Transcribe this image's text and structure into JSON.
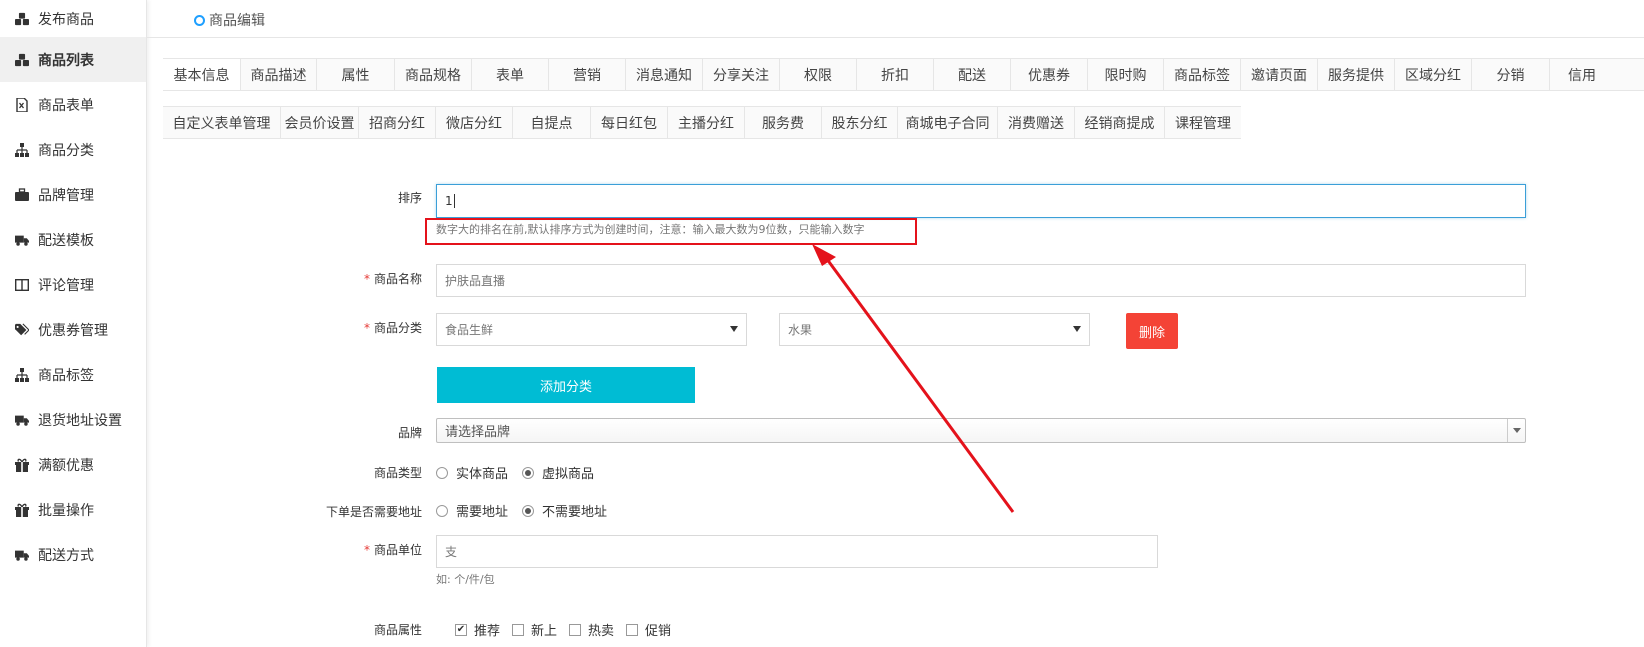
{
  "sidebar": {
    "items": [
      {
        "label": "发布商品",
        "icon": "cubes-icon",
        "active": false
      },
      {
        "label": "商品列表",
        "icon": "cubes-icon",
        "active": true
      },
      {
        "label": "商品表单",
        "icon": "excel-file-icon",
        "active": false
      },
      {
        "label": "商品分类",
        "icon": "sitemap-icon",
        "active": false
      },
      {
        "label": "品牌管理",
        "icon": "briefcase-icon",
        "active": false
      },
      {
        "label": "配送模板",
        "icon": "truck-icon",
        "active": false
      },
      {
        "label": "评论管理",
        "icon": "columns-icon",
        "active": false
      },
      {
        "label": "优惠券管理",
        "icon": "tags-icon",
        "active": false
      },
      {
        "label": "商品标签",
        "icon": "sitemap-icon",
        "active": false
      },
      {
        "label": "退货地址设置",
        "icon": "truck-icon",
        "active": false
      },
      {
        "label": "满额优惠",
        "icon": "gift-icon",
        "active": false
      },
      {
        "label": "批量操作",
        "icon": "gift-icon",
        "active": false
      },
      {
        "label": "配送方式",
        "icon": "truck-icon",
        "active": false
      }
    ]
  },
  "header": {
    "breadcrumb": "商品编辑"
  },
  "tabs_row1": [
    "基本信息",
    "商品描述",
    "属性",
    "商品规格",
    "表单",
    "营销",
    "消息通知",
    "分享关注",
    "权限",
    "折扣",
    "配送",
    "优惠券",
    "限时购",
    "商品标签",
    "邀请页面",
    "服务提供",
    "区域分红",
    "分销",
    "信用"
  ],
  "tabs_row2": [
    "自定义表单管理",
    "会员价设置",
    "招商分红",
    "微店分红",
    "自提点",
    "每日红包",
    "主播分红",
    "服务费",
    "股东分红",
    "商城电子合同",
    "消费赠送",
    "经销商提成",
    "课程管理"
  ],
  "form": {
    "sort": {
      "label": "排序",
      "value": "1",
      "hint": "数字大的排名在前,默认排序方式为创建时间，注意：输入最大数为9位数，只能输入数字"
    },
    "name": {
      "required": "*",
      "label": "商品名称",
      "value": "护肤品直播"
    },
    "category": {
      "required": "*",
      "label": "商品分类",
      "primary": "食品生鲜",
      "secondary": "水果",
      "delete_label": "删除",
      "add_label": "添加分类"
    },
    "brand": {
      "label": "品牌",
      "placeholder": "请选择品牌"
    },
    "product_type": {
      "label": "商品类型",
      "options": [
        "实体商品",
        "虚拟商品"
      ],
      "selected": 1
    },
    "need_address": {
      "label": "下单是否需要地址",
      "options": [
        "需要地址",
        "不需要地址"
      ],
      "selected": 1
    },
    "unit": {
      "required": "*",
      "label": "商品单位",
      "value": "支",
      "hint": "如: 个/件/包"
    },
    "attributes": {
      "label": "商品属性",
      "options": [
        {
          "text": "推荐",
          "checked": true
        },
        {
          "text": "新上",
          "checked": false
        },
        {
          "text": "热卖",
          "checked": false
        },
        {
          "text": "促销",
          "checked": false
        }
      ]
    }
  },
  "colors": {
    "accent": "#00bcd4",
    "danger": "#f44336",
    "annotation": "#e4121b",
    "focus": "#3b9fd8"
  }
}
